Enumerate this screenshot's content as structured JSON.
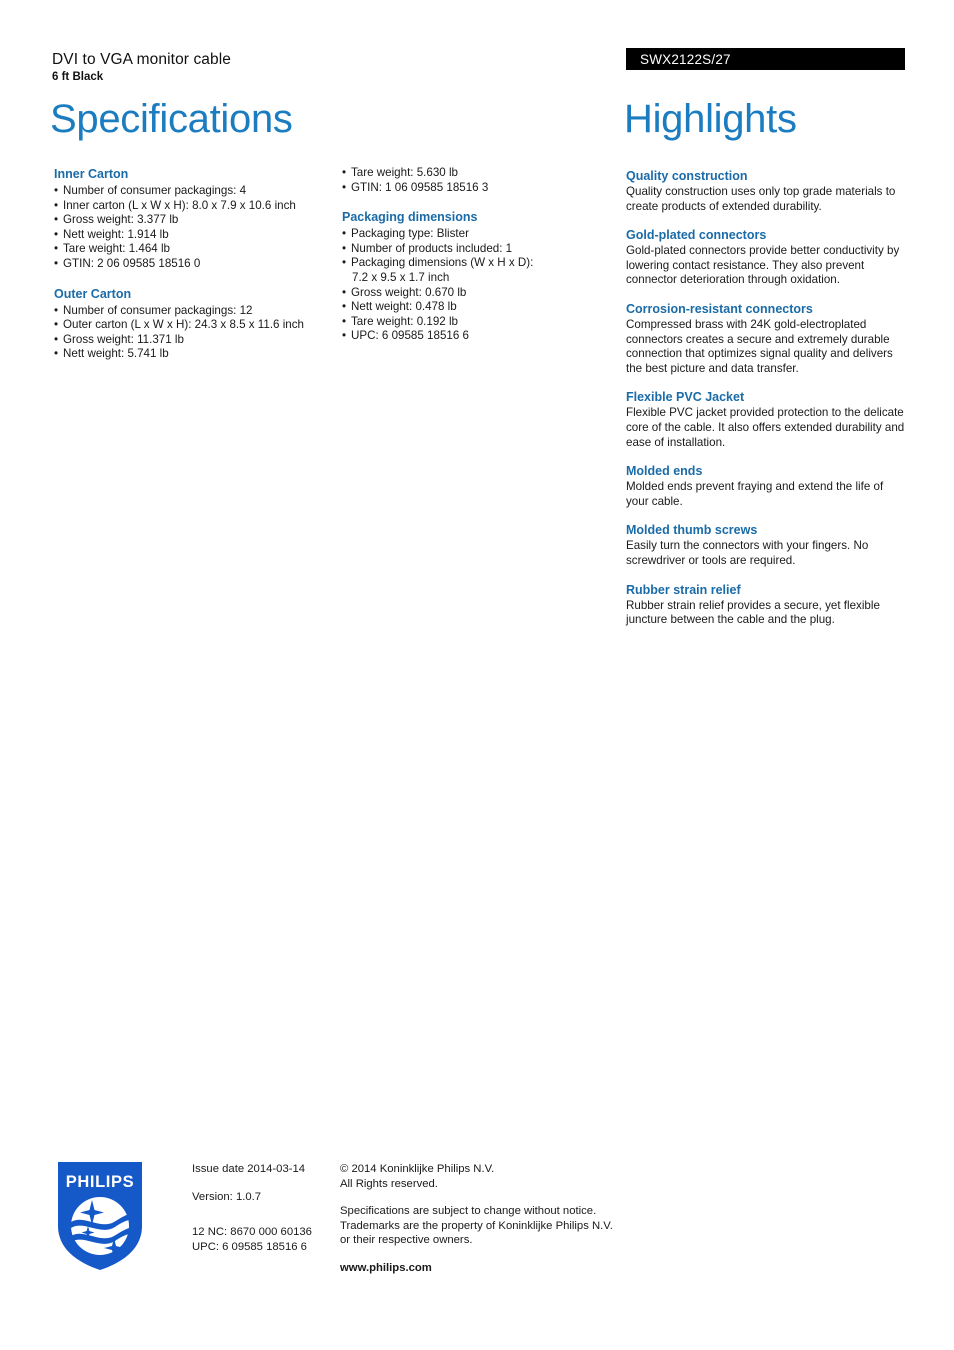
{
  "header": {
    "product_name": "DVI to VGA monitor cable",
    "product_variant": "6 ft Black",
    "page_title": "Specifications",
    "model_number": "SWX2122S/27",
    "highlights_title": "Highlights",
    "accent_color": "#1b7cc0",
    "heading_color": "#1a6ba8"
  },
  "spec_columns": [
    {
      "groups": [
        {
          "heading": "Inner Carton",
          "items": [
            {
              "text": "Number of consumer packagings: 4"
            },
            {
              "text": "Inner carton (L x W x H): 8.0 x 7.9 x 10.6 inch"
            },
            {
              "text": "Gross weight: 3.377 lb"
            },
            {
              "text": "Nett weight: 1.914 lb"
            },
            {
              "text": "Tare weight: 1.464 lb"
            },
            {
              "text": "GTIN: 2 06 09585 18516 0"
            }
          ]
        },
        {
          "heading": "Outer Carton",
          "items": [
            {
              "text": "Number of consumer packagings: 12"
            },
            {
              "text": "Outer carton (L x W x H): 24.3 x 8.5 x 11.6 inch"
            },
            {
              "text": "Gross weight: 11.371 lb"
            },
            {
              "text": "Nett weight: 5.741 lb"
            }
          ]
        }
      ]
    },
    {
      "groups": [
        {
          "heading": "",
          "items": [
            {
              "text": "Tare weight: 5.630 lb"
            },
            {
              "text": "GTIN: 1 06 09585 18516 3"
            }
          ]
        },
        {
          "heading": "Packaging dimensions",
          "items": [
            {
              "text": "Packaging type: Blister"
            },
            {
              "text": "Number of products included: 1"
            },
            {
              "text": "Packaging dimensions (W x H x D):",
              "continuation": "7.2 x 9.5 x 1.7 inch"
            },
            {
              "text": "Gross weight: 0.670 lb"
            },
            {
              "text": "Nett weight: 0.478 lb"
            },
            {
              "text": "Tare weight: 0.192 lb"
            },
            {
              "text": "UPC: 6 09585 18516 6"
            }
          ]
        }
      ]
    }
  ],
  "highlights": [
    {
      "heading": "Quality construction",
      "body": "Quality construction uses only top grade materials to create products of extended durability."
    },
    {
      "heading": "Gold-plated connectors",
      "body": "Gold-plated connectors provide better conductivity by lowering contact resistance. They also prevent connector deterioration through oxidation."
    },
    {
      "heading": "Corrosion-resistant connectors",
      "body": "Compressed brass with 24K gold-electroplated connectors creates a secure and extremely durable connection that optimizes signal quality and delivers the best picture and data transfer."
    },
    {
      "heading": "Flexible PVC Jacket",
      "body": "Flexible PVC jacket provided protection to the delicate core of the cable. It also offers extended durability and ease of installation."
    },
    {
      "heading": "Molded ends",
      "body": "Molded ends prevent fraying and extend the life of your cable."
    },
    {
      "heading": "Molded thumb screws",
      "body": "Easily turn the connectors with your fingers. No screwdriver or tools are required."
    },
    {
      "heading": "Rubber strain relief",
      "body": "Rubber strain relief provides a secure, yet flexible juncture between the cable and the plug."
    }
  ],
  "footer": {
    "logo_wordmark": "PHILIPS",
    "logo_color": "#1558c8",
    "issue_date": "Issue date 2014-03-14",
    "version": "Version: 1.0.7",
    "twelve_nc": "12 NC: 8670 000 60136",
    "upc": "UPC: 6 09585 18516 6",
    "copyright_line1": "© 2014 Koninklijke Philips N.V.",
    "copyright_line2": "All Rights reserved.",
    "disclaimer_line1": "Specifications are subject to change without notice.",
    "disclaimer_line2": "Trademarks are the property of Koninklijke Philips N.V.",
    "disclaimer_line3": "or their respective owners.",
    "website": "www.philips.com"
  }
}
